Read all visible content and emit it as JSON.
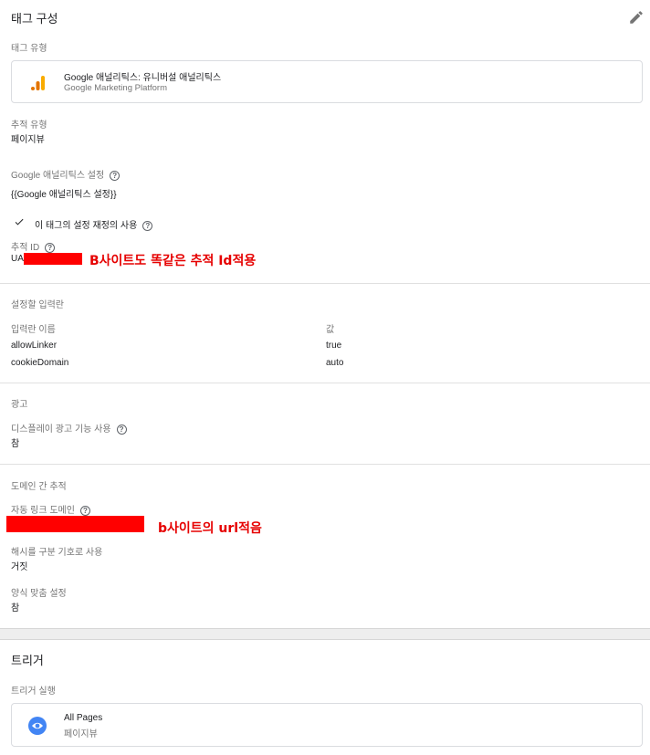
{
  "tag_config": {
    "title": "태그 구성",
    "tag_type_label": "태그 유형",
    "tag_type_name": "Google 애널리틱스: 유니버설 애널리틱스",
    "tag_type_sub": "Google Marketing Platform",
    "track_type_label": "추적 유형",
    "track_type_value": "페이지뷰",
    "ga_settings_label": "Google 애널리틱스 설정",
    "ga_settings_value": "{{Google 애널리틱스 설정}}",
    "override_label": "이 태그의 설정 재정의 사용",
    "tracking_id_label": "추적 ID",
    "tracking_id_prefix": "UA",
    "tracking_id_annotation": "B사이트도 똑같은 추적 Id적용",
    "fields_label": "설정할 입력란",
    "fields_col_name": "입력란 이름",
    "fields_col_value": "값",
    "fields_rows": [
      {
        "name": "allowLinker",
        "value": "true"
      },
      {
        "name": "cookieDomain",
        "value": "auto"
      }
    ],
    "ads_label": "광고",
    "display_ads_label": "디스플레이 광고 기능 사용",
    "display_ads_value": "참",
    "cross_domain_label": "도메인 간 추적",
    "auto_link_label": "자동 링크 도메인",
    "auto_link_annotation": "b사이트의 url적음",
    "hash_label": "해시를 구분 기호로 사용",
    "hash_value": "거짓",
    "decorate_forms_label": "양식 맞춤 설정",
    "decorate_forms_value": "참"
  },
  "triggers": {
    "title": "트리거",
    "firing_label": "트리거 실행",
    "trigger_name": "All Pages",
    "trigger_sub": "페이지뷰"
  },
  "colors": {
    "accent_blue": "#4285f4",
    "ga_orange": "#f9ab00",
    "ga_dark_orange": "#e37400",
    "annotation_red": "#e60000",
    "redaction_red": "#ff0000"
  }
}
